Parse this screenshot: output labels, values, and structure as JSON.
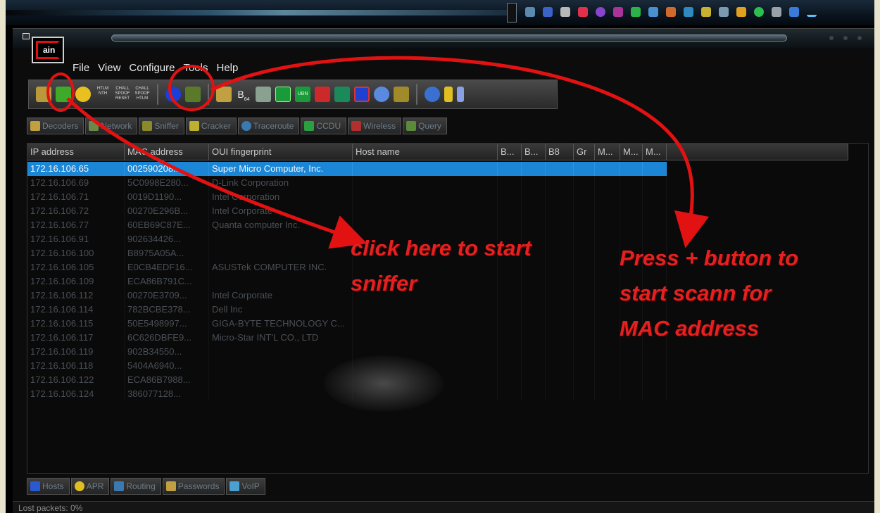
{
  "window": {
    "logo_text": "ain"
  },
  "menu": [
    "File",
    "View",
    "Configure",
    "Tools",
    "Help"
  ],
  "toolbar": {
    "text_icons": [
      "HTLM\nNTH",
      "CHALL\nSPOOF\nRESET",
      "CHALL\nSPOOF\nHTLM"
    ],
    "b64_label": "B",
    "b64_sub": "64",
    "green_labels": [
      "",
      "UBN"
    ]
  },
  "tabs": [
    {
      "label": "Decoders",
      "icon": "decoders-icon"
    },
    {
      "label": "Network",
      "icon": "network-icon"
    },
    {
      "label": "Sniffer",
      "icon": "sniffer-icon"
    },
    {
      "label": "Cracker",
      "icon": "cracker-icon"
    },
    {
      "label": "Traceroute",
      "icon": "traceroute-icon"
    },
    {
      "label": "CCDU",
      "icon": "ccdu-icon"
    },
    {
      "label": "Wireless",
      "icon": "wireless-icon"
    },
    {
      "label": "Query",
      "icon": "query-icon"
    }
  ],
  "table": {
    "columns": [
      "IP address",
      "MAC address",
      "OUI fingerprint",
      "Host name",
      "B...",
      "B...",
      "B8",
      "Gr",
      "M...",
      "M...",
      "M..."
    ],
    "rows": [
      [
        "172.16.106.65",
        "002590208...",
        "Super Micro Computer, Inc."
      ],
      [
        "172.16.106.69",
        "5C0998E280...",
        "D-Link Corporation"
      ],
      [
        "172.16.106.71",
        "0019D1190...",
        "Intel Corporation"
      ],
      [
        "172.16.106.72",
        "00270E296B...",
        "Intel Corporate"
      ],
      [
        "172.16.106.77",
        "60EB69C87E...",
        "Quanta computer Inc."
      ],
      [
        "172.16.106.91",
        "902634426...",
        ""
      ],
      [
        "172.16.106.100",
        "B8975A05A...",
        ""
      ],
      [
        "172.16.106.105",
        "E0CB4EDF16...",
        "ASUSTek COMPUTER INC."
      ],
      [
        "172.16.106.109",
        "ECA86B791C...",
        ""
      ],
      [
        "172.16.106.112",
        "00270E3709...",
        "Intel Corporate"
      ],
      [
        "172.16.106.114",
        "782BCBE378...",
        "Dell Inc"
      ],
      [
        "172.16.106.115",
        "50E5498997...",
        "GIGA-BYTE TECHNOLOGY C..."
      ],
      [
        "172.16.106.117",
        "6C626DBFE9...",
        "Micro-Star INT'L CO., LTD"
      ],
      [
        "172.16.106.119",
        "902B34550...",
        ""
      ],
      [
        "172.16.106.118",
        "5404A6940...",
        ""
      ],
      [
        "172.16.106.122",
        "ECA86B7988...",
        ""
      ],
      [
        "172.16.106.124",
        "386077128...",
        ""
      ]
    ],
    "selected_row": 0
  },
  "bottom_tabs": [
    {
      "label": "Hosts",
      "icon": "hosts-icon"
    },
    {
      "label": "APR",
      "icon": "apr-icon"
    },
    {
      "label": "Routing",
      "icon": "routing-icon"
    },
    {
      "label": "Passwords",
      "icon": "passwords-icon"
    },
    {
      "label": "VoIP",
      "icon": "voip-icon"
    }
  ],
  "status": {
    "text": "Lost packets:  0%"
  },
  "annotations": {
    "sniffer_note": [
      "click here to start",
      "sniffer"
    ],
    "scan_note": [
      "Press + button to",
      "start scann for",
      "MAC address"
    ],
    "color": "#e21212"
  },
  "colors": {
    "selection": "#1b86d6",
    "dim_text": "#4a4f55"
  }
}
